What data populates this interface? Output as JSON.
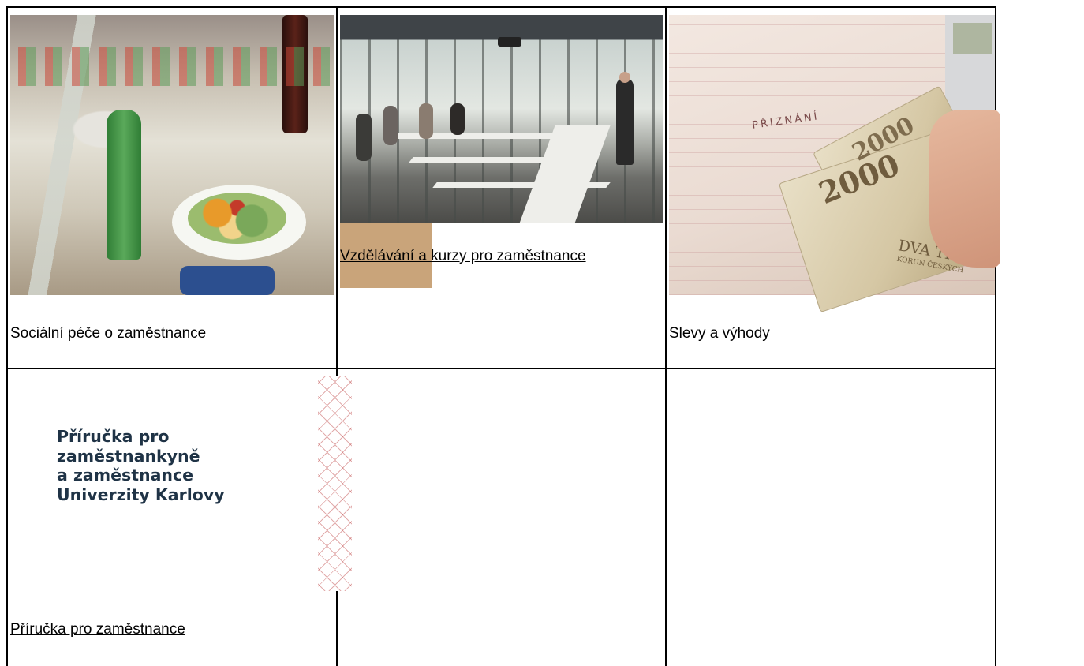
{
  "tiles": [
    {
      "link_label": "Sociální péče o zaměstnance",
      "image_alt": "cafeteria-salad-photo"
    },
    {
      "link_label": "Vzdělávání a kurzy pro zaměstnance",
      "image_alt": "classroom-lecture-photo"
    },
    {
      "link_label": "Slevy a výhody",
      "image_alt": "tax-form-money-photo"
    },
    {
      "link_label": "Příručka pro zaměstnance",
      "image_alt": "handbook-cover-image"
    }
  ],
  "handbook_cover": {
    "lines": [
      "Příručka pro",
      "zaměstnankyně",
      "a zaměstnance",
      "Univerzity Karlovy"
    ]
  },
  "money_image": {
    "form_heading": "PŘIZNÁNÍ",
    "bill_value": "2000",
    "bill_text": "DVA TISÍC",
    "bill_subtext": "KORUN ČESKÝCH"
  },
  "colors": {
    "link": "#000000",
    "border": "#000000",
    "handbook_title": "#1f3346"
  }
}
